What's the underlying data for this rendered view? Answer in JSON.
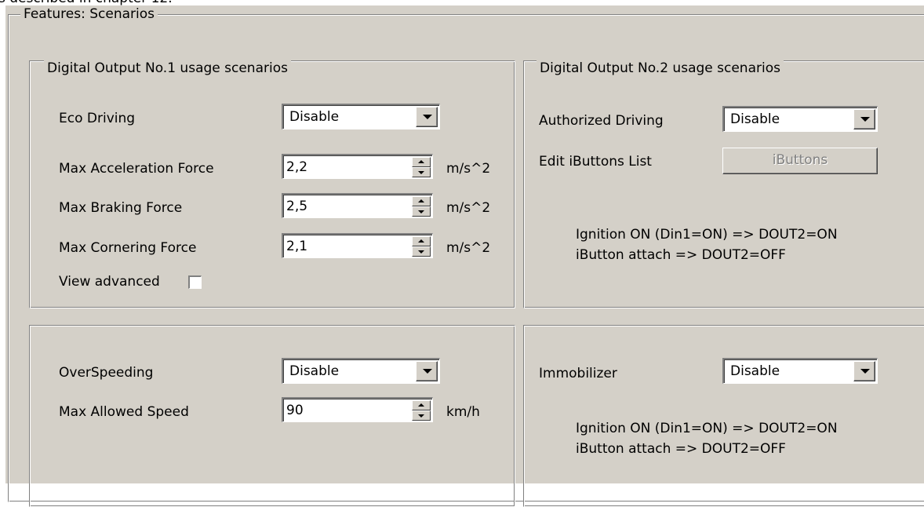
{
  "caption_above": "s described in chapter 12.",
  "features": {
    "title": "Features: Scenarios"
  },
  "dout1": {
    "title": "Digital Output No.1 usage scenarios",
    "eco_driving": {
      "label": "Eco Driving",
      "value": "Disable"
    },
    "max_accel": {
      "label": "Max Acceleration Force",
      "value": "2,2",
      "unit": "m/s^2"
    },
    "max_braking": {
      "label": "Max Braking Force",
      "value": "2,5",
      "unit": "m/s^2"
    },
    "max_cornering": {
      "label": "Max Cornering Force",
      "value": "2,1",
      "unit": "m/s^2"
    },
    "view_advanced": {
      "label": "View advanced",
      "checked": false
    }
  },
  "dout2": {
    "title": "Digital Output No.2 usage scenarios",
    "authorized_driving": {
      "label": "Authorized Driving",
      "value": "Disable"
    },
    "edit_ibuttons": {
      "label": "Edit iButtons List",
      "button": "iButtons"
    },
    "info_line1": "Ignition ON (Din1=ON) => DOUT2=ON",
    "info_line2": "iButton attach => DOUT2=OFF"
  },
  "overspeeding": {
    "label": "OverSpeeding",
    "value": "Disable",
    "max_speed": {
      "label": "Max Allowed Speed",
      "value": "90",
      "unit": "km/h"
    }
  },
  "immobilizer": {
    "label": "Immobilizer",
    "value": "Disable",
    "info_line1": "Ignition ON (Din1=ON) => DOUT2=ON",
    "info_line2": "iButton attach => DOUT2=OFF"
  }
}
